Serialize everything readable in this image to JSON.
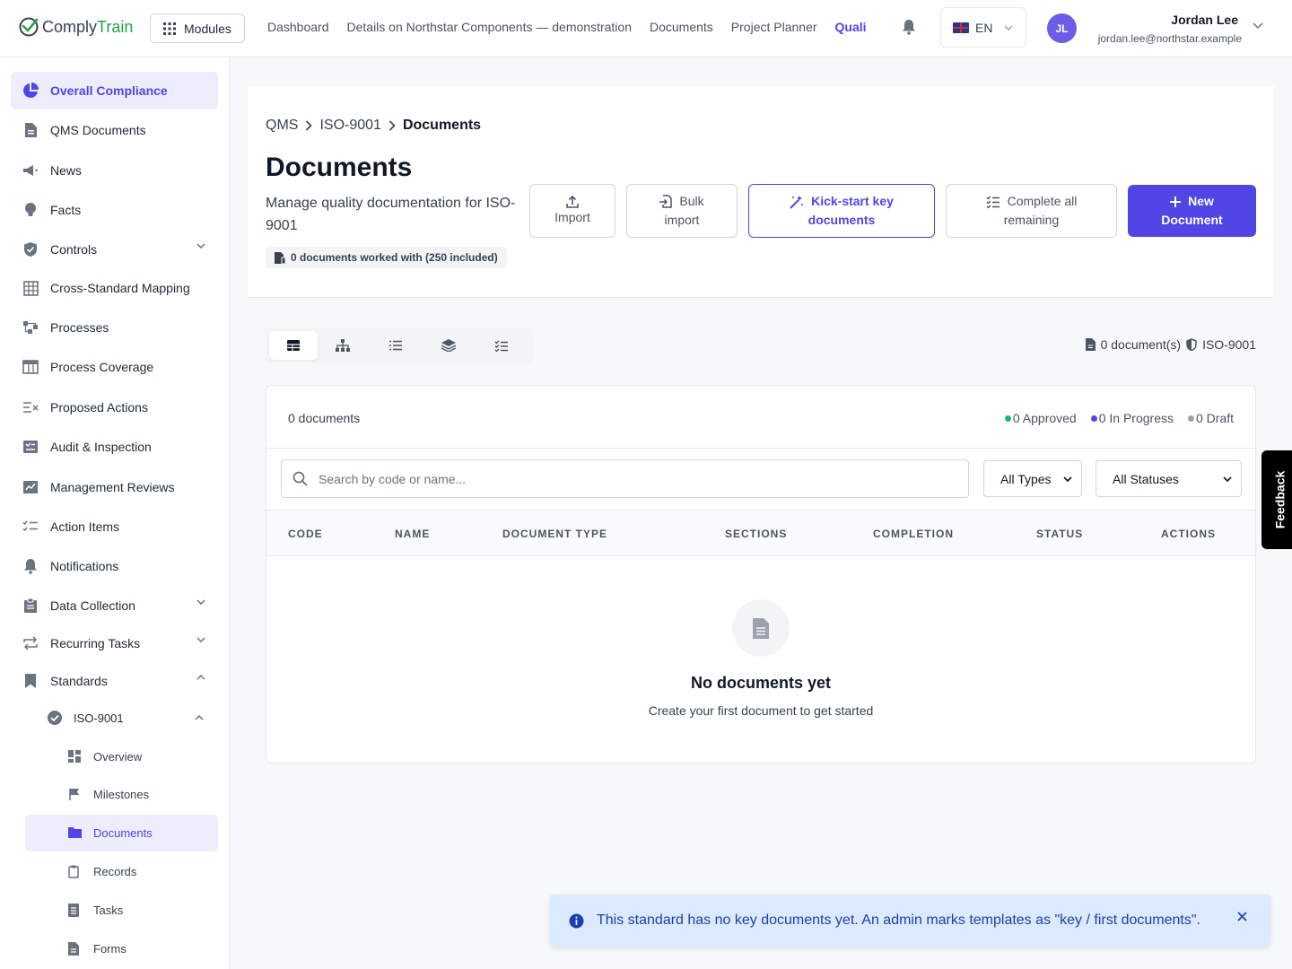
{
  "app": {
    "logo_part1": "Comply",
    "logo_part2": "Train",
    "modules_label": "Modules",
    "top_nav": [
      "Dashboard",
      "Details on Northstar Components — demonstration",
      "Documents",
      "Project Planner"
    ],
    "top_nav_active": "Quali",
    "language": "EN",
    "user": {
      "initials": "JL",
      "name": "Jordan Lee",
      "email": "jordan.lee@northstar.example"
    }
  },
  "sidebar": {
    "items": [
      {
        "label": "Overall Compliance",
        "icon": "pie-chart-icon",
        "active": true
      },
      {
        "label": "QMS Documents",
        "icon": "document-icon"
      },
      {
        "label": "News",
        "icon": "megaphone-icon"
      },
      {
        "label": "Facts",
        "icon": "lightbulb-icon"
      },
      {
        "label": "Controls",
        "icon": "shield-check-icon",
        "expandable": true
      },
      {
        "label": "Cross-Standard Mapping",
        "icon": "grid-icon"
      },
      {
        "label": "Processes",
        "icon": "flow-icon"
      },
      {
        "label": "Process Coverage",
        "icon": "table-icon"
      },
      {
        "label": "Proposed Actions",
        "icon": "list-x-icon"
      },
      {
        "label": "Audit & Inspection",
        "icon": "checklist-icon"
      },
      {
        "label": "Management Reviews",
        "icon": "chart-board-icon"
      },
      {
        "label": "Action Items",
        "icon": "tasks-icon"
      },
      {
        "label": "Notifications",
        "icon": "bell-icon"
      },
      {
        "label": "Data Collection",
        "icon": "clipboard-icon",
        "expandable": true
      },
      {
        "label": "Recurring Tasks",
        "icon": "repeat-icon",
        "expandable": true
      },
      {
        "label": "Standards",
        "icon": "bookmark-icon",
        "expanded": true
      }
    ],
    "standard": {
      "label": "ISO-9001",
      "icon": "badge-check-icon"
    },
    "standard_children": [
      {
        "label": "Overview",
        "icon": "dashboard-icon"
      },
      {
        "label": "Milestones",
        "icon": "flag-icon"
      },
      {
        "label": "Documents",
        "icon": "folder-icon",
        "active": true
      },
      {
        "label": "Records",
        "icon": "clipboard-icon"
      },
      {
        "label": "Tasks",
        "icon": "list-doc-icon"
      },
      {
        "label": "Forms",
        "icon": "form-icon"
      }
    ]
  },
  "header": {
    "breadcrumb": [
      "QMS",
      "ISO-9001",
      "Documents"
    ],
    "title": "Documents",
    "description": "Manage quality documentation for ISO-9001",
    "badge": "0 documents worked with (250 included)",
    "buttons": {
      "import": "Import",
      "bulk_import_1": "Bulk",
      "bulk_import_2": "import",
      "kickstart_1": "Kick-start key",
      "kickstart_2": "documents",
      "complete_1": "Complete all",
      "complete_2": "remaining",
      "new_doc_1": "New",
      "new_doc_2": "Document"
    }
  },
  "view": {
    "tabs": [
      "table-view-icon",
      "hierarchy-view-icon",
      "list-view-icon",
      "layers-view-icon",
      "checklist-view-icon"
    ],
    "doc_count": "0 document(s)",
    "standard": "ISO-9001"
  },
  "table": {
    "count_label": "0 documents",
    "legend": [
      {
        "label": "0 Approved",
        "color": "#10b981"
      },
      {
        "label": "0 In Progress",
        "color": "#4f46e5"
      },
      {
        "label": "0 Draft",
        "color": "#9ca3af"
      }
    ],
    "search_placeholder": "Search by code or name...",
    "type_filter": "All Types",
    "status_filter": "All Statuses",
    "columns": [
      "CODE",
      "NAME",
      "DOCUMENT TYPE",
      "SECTIONS",
      "COMPLETION",
      "STATUS",
      "ACTIONS"
    ],
    "empty_title": "No documents yet",
    "empty_subtitle": "Create your first document to get started"
  },
  "feedback_label": "Feedback",
  "toast": {
    "message": "This standard has no key documents yet. An admin marks templates as \"key / first documents\"."
  },
  "colors": {
    "accent": "#4f46e5",
    "brand_green": "#22a34a",
    "toast_bg": "#dbeafe"
  }
}
